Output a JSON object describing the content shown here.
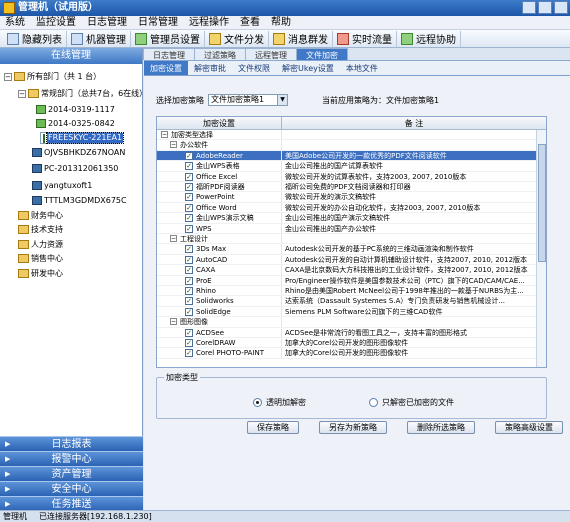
{
  "app": {
    "title": "管理机（试用版）"
  },
  "menu": [
    "系统",
    "监控设置",
    "日志管理",
    "日常管理",
    "远程操作",
    "查看",
    "帮助"
  ],
  "toolbar": [
    {
      "label": "隐藏列表",
      "icon": "list-icon"
    },
    {
      "label": "机器管理",
      "icon": "computer-icon"
    },
    {
      "label": "管理员设置",
      "icon": "admin-icon"
    },
    {
      "label": "文件分发",
      "icon": "file-distribute-icon"
    },
    {
      "label": "消息群发",
      "icon": "message-icon"
    },
    {
      "label": "实时流量",
      "icon": "traffic-icon"
    },
    {
      "label": "远程协助",
      "icon": "remote-assist-icon"
    }
  ],
  "left": {
    "header": "在线管理",
    "tree": [
      {
        "label": "所有部门（共 1 台）",
        "type": "root"
      },
      {
        "label": "常规部门（总共7台，6在线）",
        "type": "folder"
      },
      {
        "label": "2014-0319-1117",
        "type": "pc-online"
      },
      {
        "label": "2014-0325-0842",
        "type": "pc-online"
      },
      {
        "label": "FREESKYC-221EA1",
        "type": "pc-online"
      },
      {
        "label": "OJVSBHKDZ67NOAN",
        "type": "pc"
      },
      {
        "label": "PC-201312061350",
        "type": "pc"
      },
      {
        "label": "yangtuxoft1",
        "type": "pc"
      },
      {
        "label": "TTTLM3GDMDX675C",
        "type": "pc"
      },
      {
        "label": "财务中心",
        "type": "folder"
      },
      {
        "label": "技术支持",
        "type": "folder"
      },
      {
        "label": "人力资源",
        "type": "folder"
      },
      {
        "label": "销售中心",
        "type": "folder"
      },
      {
        "label": "研发中心",
        "type": "folder"
      }
    ],
    "accordion": [
      "日志报表",
      "报警中心",
      "资产管理",
      "安全中心",
      "任务推送"
    ]
  },
  "tabs_top": [
    "日志管理",
    "过滤策略",
    "远程管理",
    "文件加密"
  ],
  "tabs_sub": [
    "加密设置",
    "解密审批",
    "文件权限",
    "解密Ukey设置",
    "本地文件"
  ],
  "policy": {
    "select_label": "选择加密策略",
    "select_value": "文件加密策略1",
    "current_label": "当前应用策略为：文件加密策略1"
  },
  "grid": {
    "headers": [
      "加密设置",
      "备 注"
    ],
    "rows": [
      {
        "level": 0,
        "label": "加密类型选择",
        "note": "",
        "type": "group"
      },
      {
        "level": 1,
        "label": "办公软件",
        "note": "",
        "type": "group"
      },
      {
        "level": 2,
        "label": "AdobeReader",
        "note": "美国Adobe公司开发的一款优秀的PDF文件阅读软件"
      },
      {
        "level": 2,
        "label": "金山WPS表格",
        "note": "金山公司推出的国产试算表软件"
      },
      {
        "level": 2,
        "label": "Office Excel",
        "note": "微软公司开发的试算表软件，支持2003, 2007, 2010版本"
      },
      {
        "level": 2,
        "label": "福昕PDF阅读器",
        "note": "福昕公司免费的PDF文档阅读器和打印器"
      },
      {
        "level": 2,
        "label": "PowerPoint",
        "note": "微软公司开发的演示文稿软件"
      },
      {
        "level": 2,
        "label": "Office Word",
        "note": "微软公司开发的办公自动化软件，支持2003, 2007, 2010版本"
      },
      {
        "level": 2,
        "label": "金山WPS演示文稿",
        "note": "金山公司推出的国产演示文稿软件"
      },
      {
        "level": 2,
        "label": "WPS",
        "note": "金山公司推出的国产办公软件"
      },
      {
        "level": 1,
        "label": "工程设计",
        "note": "",
        "type": "group"
      },
      {
        "level": 2,
        "label": "3Ds Max",
        "note": "Autodesk公司开发的基于PC系统的三维动画渲染和制作软件"
      },
      {
        "level": 2,
        "label": "AutoCAD",
        "note": "Autodesk公司开发的自动计算机辅助设计软件，支持2007, 2010, 2012版本"
      },
      {
        "level": 2,
        "label": "CAXA",
        "note": "CAXA是北京数码大方科技推出的工业设计软件，支持2007, 2010, 2012版本"
      },
      {
        "level": 2,
        "label": "ProE",
        "note": "Pro/Engineer操作软件是美国参数技术公司（PTC）旗下的CAD/CAM/CAE..."
      },
      {
        "level": 2,
        "label": "Rhino",
        "note": "Rhino是由美国Robert McNeel公司于1998年推出的一款基于NURBS为主..."
      },
      {
        "level": 2,
        "label": "Solidworks",
        "note": "达索系统（Dassault Systemes S.A）专门负责研发与销售机械设计..."
      },
      {
        "level": 2,
        "label": "SolidEdge",
        "note": "Siemens PLM Software公司旗下的三维CAD软件"
      },
      {
        "level": 1,
        "label": "图形图像",
        "note": "",
        "type": "group"
      },
      {
        "level": 2,
        "label": "ACDSee",
        "note": "ACDSee是非常流行的看图工具之一，支持丰富的图形格式"
      },
      {
        "level": 2,
        "label": "CorelDRAW",
        "note": "加拿大的Corel公司开发的图形图像软件"
      },
      {
        "level": 2,
        "label": "Corel PHOTO-PAINT",
        "note": "加拿大的Corel公司开发的图形图像软件"
      }
    ]
  },
  "mode": {
    "legend": "加密类型",
    "options": [
      {
        "label": "透明加解密",
        "selected": true
      },
      {
        "label": "只解密已加密的文件",
        "selected": false
      }
    ]
  },
  "buttons": [
    "保存策略",
    "另存为新策略",
    "删除所选策略",
    "策略高级设置"
  ],
  "status": {
    "left": "管理机",
    "server": "已连接服务器[192.168.1.230]"
  }
}
